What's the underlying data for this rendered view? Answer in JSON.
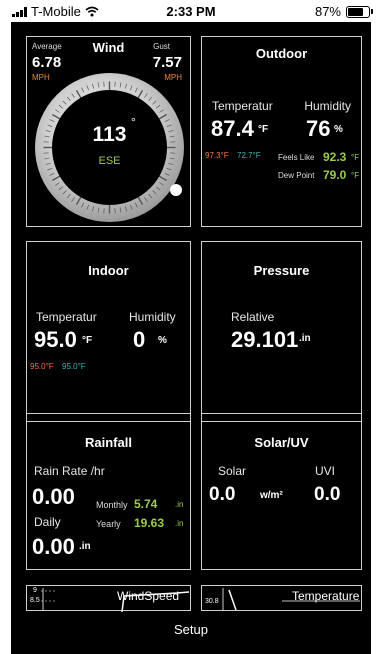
{
  "status_bar": {
    "carrier": "T-Mobile",
    "time": "2:33 PM",
    "battery": "87%",
    "battery_level": 0.87
  },
  "wind": {
    "title": "Wind",
    "average_label": "Average",
    "average_value": "6.78",
    "average_unit": "MPH",
    "gust_label": "Gust",
    "gust_value": "7.57",
    "gust_unit": "MPH",
    "direction_degrees": "113",
    "degree_symbol": "°",
    "direction_text": "ESE"
  },
  "outdoor": {
    "title": "Outdoor",
    "temperature_label": "Temperatur",
    "temperature_value": "87.4",
    "temperature_unit": "°F",
    "humidity_label": "Humidity",
    "humidity_value": "76",
    "humidity_unit": "%",
    "high": "97.3°F",
    "low": "72.7°F",
    "feels_like_label": "Feels Like",
    "feels_like_value": "92.3",
    "feels_like_unit": "°F",
    "dew_point_label": "Dew Point",
    "dew_point_value": "79.0",
    "dew_point_unit": "°F"
  },
  "indoor": {
    "title": "Indoor",
    "temperature_label": "Temperatur",
    "temperature_value": "95.0",
    "temperature_unit": "°F",
    "humidity_label": "Humidity",
    "humidity_value": "0",
    "humidity_unit": "%",
    "high": "95.0°F",
    "low": "95.0°F"
  },
  "pressure": {
    "title": "Pressure",
    "relative_label": "Relative",
    "relative_value": "29.101",
    "relative_unit": ".in"
  },
  "rainfall": {
    "title": "Rainfall",
    "rate_label": "Rain Rate /hr",
    "rate_value": "0.00",
    "daily_label": "Daily",
    "daily_value": "0.00",
    "daily_unit": ".in",
    "monthly_label": "Monthly",
    "monthly_value": "5.74",
    "monthly_unit": ".in",
    "yearly_label": "Yearly",
    "yearly_value": "19.63",
    "yearly_unit": ".in"
  },
  "solar_uv": {
    "title": "Solar/UV",
    "solar_label": "Solar",
    "solar_value": "0.0",
    "solar_unit": "w/m²",
    "uvi_label": "UVI",
    "uvi_value": "0.0"
  },
  "mini_charts": {
    "windspeed_title": "WindSpeed",
    "windspeed_ticks": [
      "9",
      "8.5"
    ],
    "temperature_title": "Temperature",
    "temperature_tick": "30.8"
  },
  "footer": {
    "setup_label": "Setup"
  }
}
